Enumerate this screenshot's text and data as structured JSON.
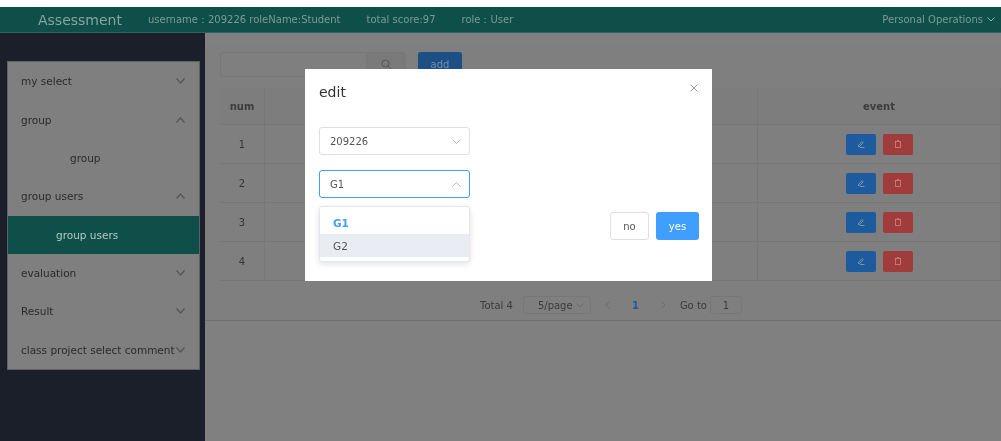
{
  "header": {
    "title": "Assessment",
    "user_info": "username：209226 roleName:Student",
    "score": "total score:97",
    "role": "role：User",
    "menu": "Personal Operations"
  },
  "toolbar": {
    "add_button": "add"
  },
  "sidebar": {
    "items": [
      {
        "label": "my select",
        "expanded": false
      },
      {
        "label": "group",
        "expanded": true,
        "children": [
          {
            "label": "group",
            "selected": false
          }
        ]
      },
      {
        "label": "group users",
        "expanded": true,
        "children": [
          {
            "label": "group users",
            "selected": true
          }
        ]
      },
      {
        "label": "evaluation",
        "expanded": false
      },
      {
        "label": "Result",
        "expanded": false
      },
      {
        "label": "class project select comment",
        "expanded": false
      }
    ]
  },
  "table": {
    "columns": [
      "num",
      "event"
    ],
    "rows": [
      "1",
      "2",
      "3",
      "4"
    ]
  },
  "pagination": {
    "total": "Total 4",
    "page_size": "5/page",
    "page": "1",
    "goto_label": "Go to",
    "goto_value": "1"
  },
  "modal": {
    "title": "edit",
    "user_select": "209226",
    "group_select": "G1",
    "options": [
      {
        "label": "G1",
        "selected": true,
        "hovered": false
      },
      {
        "label": "G2",
        "selected": false,
        "hovered": true
      }
    ],
    "buttons": [
      "no",
      "yes"
    ]
  }
}
